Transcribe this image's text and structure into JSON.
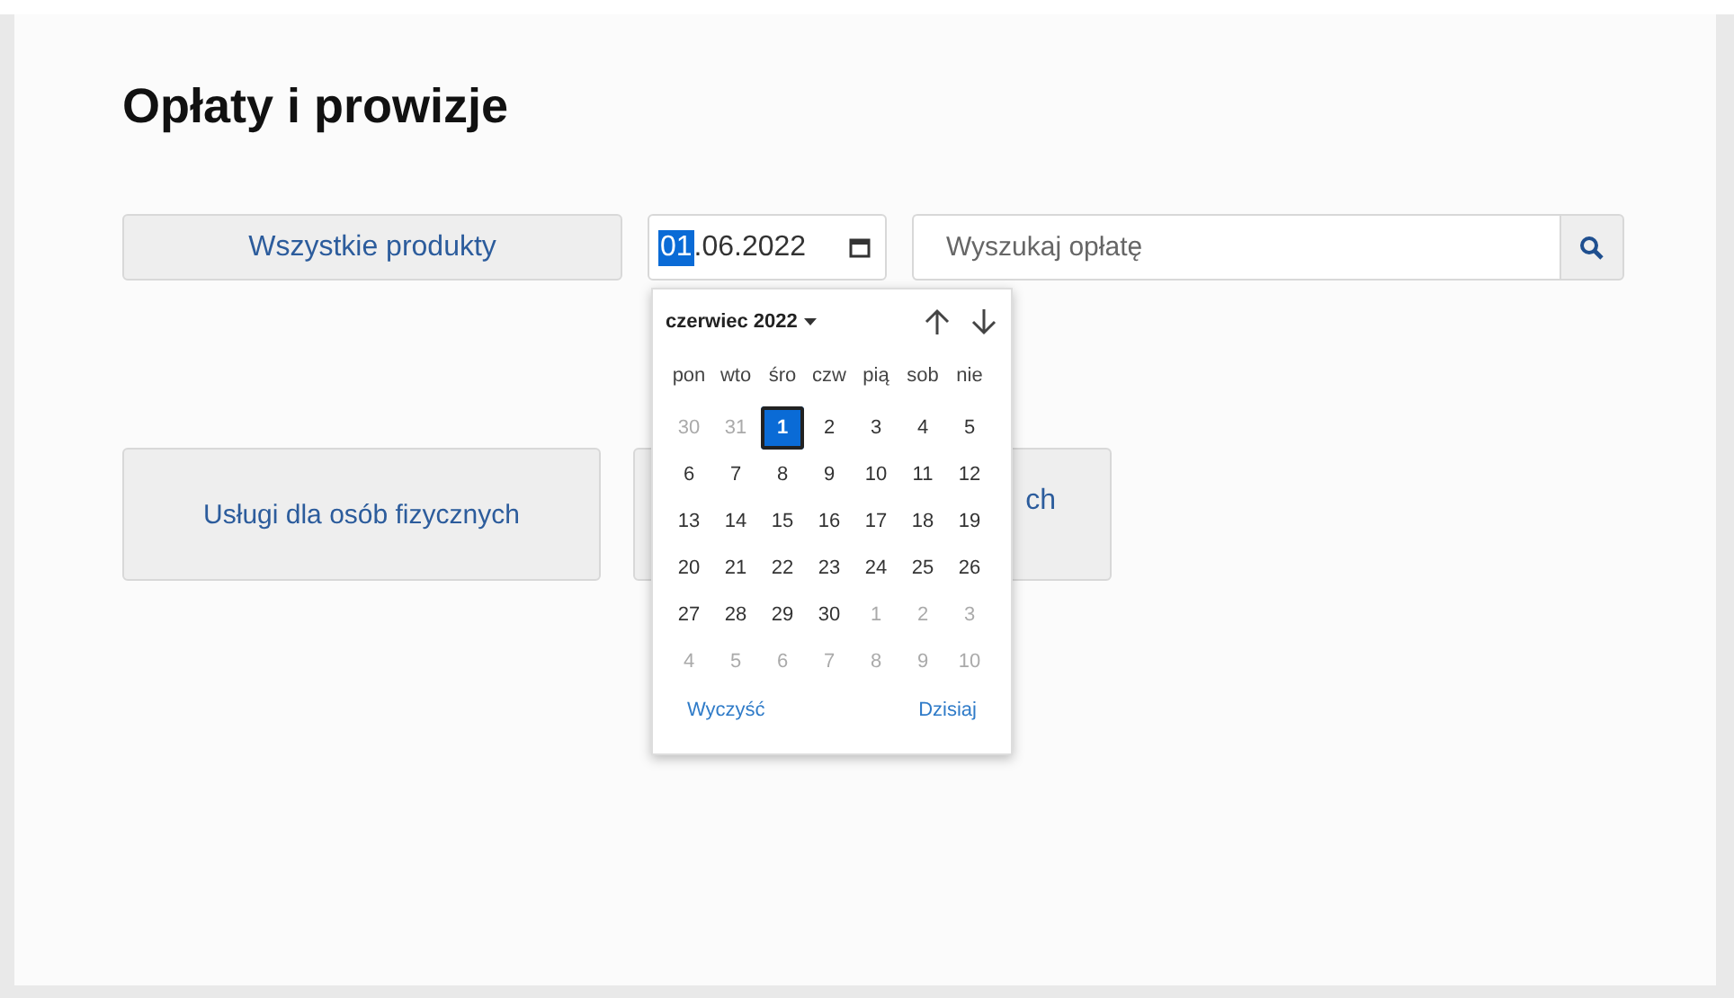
{
  "title": "Opłaty i prowizje",
  "product_button": "Wszystkie produkty",
  "date_field": {
    "day": "01",
    "day_selected": true,
    "rest": ".06.2022"
  },
  "search": {
    "placeholder": "Wyszukaj opłatę"
  },
  "cards": [
    {
      "label": "Usługi dla osób fizycznych"
    },
    {
      "label": "ch"
    }
  ],
  "datepicker": {
    "month": "czerwiec 2022",
    "weekdays": [
      "pon",
      "wto",
      "śro",
      "czw",
      "pią",
      "sob",
      "nie"
    ],
    "days": [
      {
        "label": "30",
        "outside": true,
        "selected": false
      },
      {
        "label": "31",
        "outside": true,
        "selected": false
      },
      {
        "label": "1",
        "outside": false,
        "selected": true
      },
      {
        "label": "2",
        "outside": false,
        "selected": false
      },
      {
        "label": "3",
        "outside": false,
        "selected": false
      },
      {
        "label": "4",
        "outside": false,
        "selected": false
      },
      {
        "label": "5",
        "outside": false,
        "selected": false
      },
      {
        "label": "6",
        "outside": false,
        "selected": false
      },
      {
        "label": "7",
        "outside": false,
        "selected": false
      },
      {
        "label": "8",
        "outside": false,
        "selected": false
      },
      {
        "label": "9",
        "outside": false,
        "selected": false
      },
      {
        "label": "10",
        "outside": false,
        "selected": false
      },
      {
        "label": "11",
        "outside": false,
        "selected": false
      },
      {
        "label": "12",
        "outside": false,
        "selected": false
      },
      {
        "label": "13",
        "outside": false,
        "selected": false
      },
      {
        "label": "14",
        "outside": false,
        "selected": false
      },
      {
        "label": "15",
        "outside": false,
        "selected": false
      },
      {
        "label": "16",
        "outside": false,
        "selected": false
      },
      {
        "label": "17",
        "outside": false,
        "selected": false
      },
      {
        "label": "18",
        "outside": false,
        "selected": false
      },
      {
        "label": "19",
        "outside": false,
        "selected": false
      },
      {
        "label": "20",
        "outside": false,
        "selected": false
      },
      {
        "label": "21",
        "outside": false,
        "selected": false
      },
      {
        "label": "22",
        "outside": false,
        "selected": false
      },
      {
        "label": "23",
        "outside": false,
        "selected": false
      },
      {
        "label": "24",
        "outside": false,
        "selected": false
      },
      {
        "label": "25",
        "outside": false,
        "selected": false
      },
      {
        "label": "26",
        "outside": false,
        "selected": false
      },
      {
        "label": "27",
        "outside": false,
        "selected": false
      },
      {
        "label": "28",
        "outside": false,
        "selected": false
      },
      {
        "label": "29",
        "outside": false,
        "selected": false
      },
      {
        "label": "30",
        "outside": false,
        "selected": false
      },
      {
        "label": "1",
        "outside": true,
        "selected": false
      },
      {
        "label": "2",
        "outside": true,
        "selected": false
      },
      {
        "label": "3",
        "outside": true,
        "selected": false
      },
      {
        "label": "4",
        "outside": true,
        "selected": false
      },
      {
        "label": "5",
        "outside": true,
        "selected": false
      },
      {
        "label": "6",
        "outside": true,
        "selected": false
      },
      {
        "label": "7",
        "outside": true,
        "selected": false
      },
      {
        "label": "8",
        "outside": true,
        "selected": false
      },
      {
        "label": "9",
        "outside": true,
        "selected": false
      },
      {
        "label": "10",
        "outside": true,
        "selected": false
      }
    ],
    "clear_link": "Wyczyść",
    "today_link": "Dzisiaj"
  }
}
